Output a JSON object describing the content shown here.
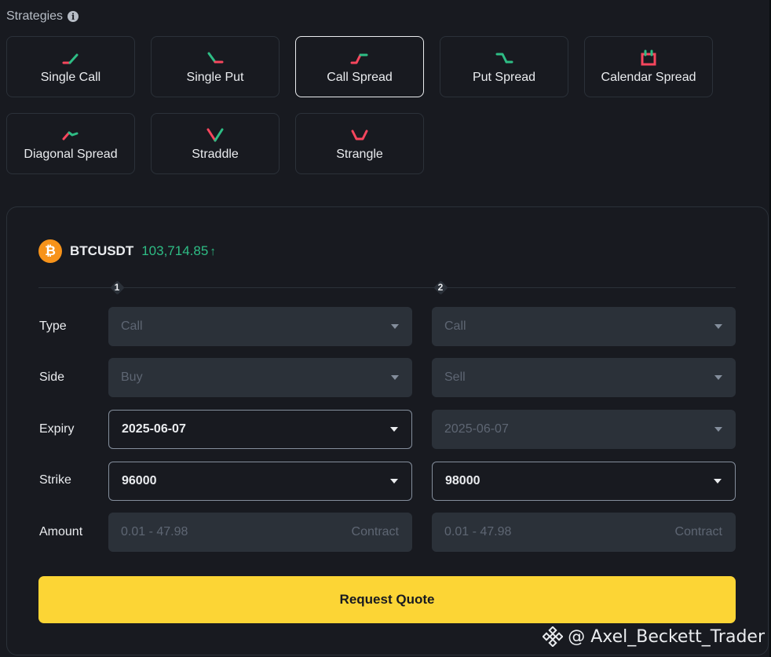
{
  "header": {
    "title": "Strategies",
    "info_icon": "info-icon"
  },
  "strategies": [
    {
      "label": "Single Call",
      "icon": "single-call-icon"
    },
    {
      "label": "Single Put",
      "icon": "single-put-icon"
    },
    {
      "label": "Call Spread",
      "icon": "call-spread-icon",
      "selected": true
    },
    {
      "label": "Put Spread",
      "icon": "put-spread-icon"
    },
    {
      "label": "Calendar Spread",
      "icon": "calendar-spread-icon"
    },
    {
      "label": "Diagonal Spread",
      "icon": "diagonal-spread-icon"
    },
    {
      "label": "Straddle",
      "icon": "straddle-icon"
    },
    {
      "label": "Strangle",
      "icon": "strangle-icon"
    }
  ],
  "pair": {
    "symbol": "BTCUSDT",
    "price": "103,714.85",
    "logo_letter": "₿",
    "trend": "up"
  },
  "legs": [
    "1",
    "2"
  ],
  "form": {
    "labels": {
      "type": "Type",
      "side": "Side",
      "expiry": "Expiry",
      "strike": "Strike",
      "amount": "Amount"
    },
    "leg1": {
      "type": "Call",
      "side": "Buy",
      "expiry": "2025-06-07",
      "strike": "96000",
      "amount_placeholder": "0.01 - 47.98",
      "amount_unit": "Contract"
    },
    "leg2": {
      "type": "Call",
      "side": "Sell",
      "expiry": "2025-06-07",
      "strike": "98000",
      "amount_placeholder": "0.01 - 47.98",
      "amount_unit": "Contract"
    }
  },
  "actions": {
    "request_quote": "Request Quote"
  },
  "watermark": {
    "text": "@ Axel_Beckett_Trader"
  },
  "colors": {
    "green": "#2ebd85",
    "red": "#f6465d",
    "accent": "#fcd535",
    "bg": "#181a20"
  }
}
